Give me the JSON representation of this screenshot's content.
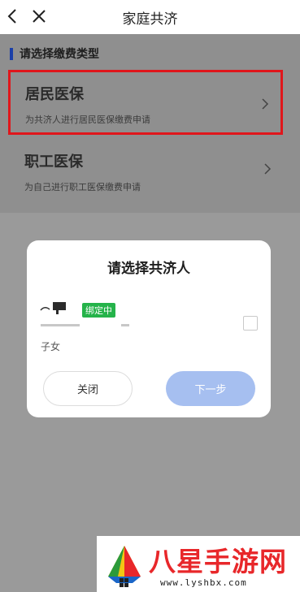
{
  "header": {
    "title": "家庭共济"
  },
  "section": {
    "title": "请选择缴费类型"
  },
  "options": [
    {
      "name": "居民医保",
      "desc": "为共济人进行居民医保缴费申请"
    },
    {
      "name": "职工医保",
      "desc": "为自己进行职工医保缴费申请"
    }
  ],
  "modal": {
    "title": "请选择共济人",
    "person": {
      "badge": "绑定中",
      "relation": "子女"
    },
    "close_label": "关闭",
    "next_label": "下一步"
  },
  "watermark": {
    "title": "八星手游网",
    "url": "www.lyshbx.com"
  },
  "colors": {
    "highlight": "#e0161b",
    "badge": "#25b34a",
    "next_button": "#a6bff0",
    "section_bar": "#1a3fa8"
  }
}
